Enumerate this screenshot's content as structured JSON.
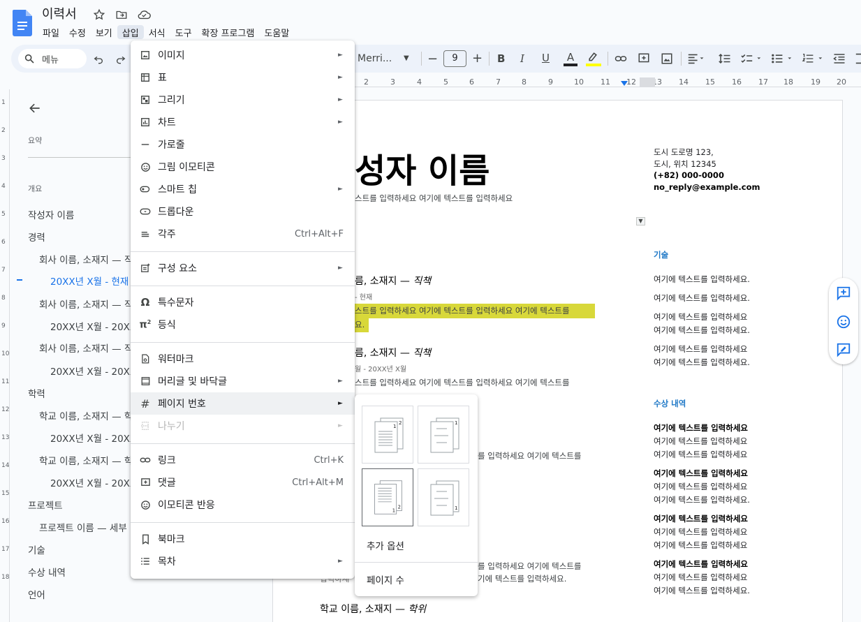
{
  "document": {
    "title": "이력서"
  },
  "menubar": [
    "파일",
    "수정",
    "보기",
    "삽입",
    "서식",
    "도구",
    "확장 프로그램",
    "도움말"
  ],
  "toolbar": {
    "menu_search": "메뉴",
    "font_name": "Merri...",
    "font_size": "9"
  },
  "ruler": [
    "2",
    "1",
    "1",
    "2",
    "3",
    "4",
    "5",
    "6",
    "7",
    "8",
    "9",
    "10",
    "11",
    "12",
    "13",
    "14",
    "15",
    "16",
    "17",
    "18",
    "19",
    "20"
  ],
  "vruler": [
    "1",
    "2",
    "3",
    "4",
    "5",
    "6",
    "7",
    "8",
    "9",
    "10",
    "11",
    "12",
    "13",
    "14",
    "15",
    "16",
    "17",
    "18"
  ],
  "outline": {
    "summary_label": "요약",
    "overview_label": "개요",
    "items": [
      "작성자 이름",
      "경력",
      "회사 이름, 소재지 — 직",
      "20XX년 X월 - 현재",
      "회사 이름, 소재지 — 직",
      "20XX년 X월 - 20XX",
      "회사 이름, 소재지 — 직",
      "20XX년 X월 - 20XX",
      "학력",
      "학교 이름, 소재지 — 학",
      "20XX년 X월 - 20XX",
      "학교 이름, 소재지 — 학",
      "20XX년 X월 - 20XX",
      "프로젝트",
      "프로젝트 이름 — 세부",
      "기술",
      "수상 내역",
      "언어"
    ]
  },
  "insert_menu": {
    "items": [
      {
        "label": "이미지",
        "icon": "image-icon",
        "submenu": true
      },
      {
        "label": "표",
        "icon": "table-icon",
        "submenu": true
      },
      {
        "label": "그리기",
        "icon": "drawing-icon",
        "submenu": true
      },
      {
        "label": "차트",
        "icon": "chart-icon",
        "submenu": true
      },
      {
        "label": "가로줄",
        "icon": "horizontal-line-icon",
        "submenu": false
      },
      {
        "label": "그림 이모티콘",
        "icon": "emoji-icon",
        "submenu": false
      },
      {
        "label": "스마트 칩",
        "icon": "smart-chip-icon",
        "submenu": true
      },
      {
        "label": "드롭다운",
        "icon": "dropdown-icon",
        "submenu": false
      },
      {
        "label": "각주",
        "icon": "footnote-icon",
        "submenu": false,
        "shortcut": "Ctrl+Alt+F"
      },
      {
        "label": "구성 요소",
        "icon": "building-blocks-icon",
        "submenu": true
      },
      {
        "label": "특수문자",
        "icon": "omega-icon",
        "submenu": false
      },
      {
        "label": "등식",
        "icon": "pi-icon",
        "submenu": false
      },
      {
        "label": "워터마크",
        "icon": "watermark-icon",
        "submenu": false
      },
      {
        "label": "머리글 및 바닥글",
        "icon": "header-footer-icon",
        "submenu": true
      },
      {
        "label": "페이지 번호",
        "icon": "hash-icon",
        "submenu": true
      },
      {
        "label": "나누기",
        "icon": "break-icon",
        "submenu": true
      },
      {
        "label": "링크",
        "icon": "link-icon",
        "submenu": false,
        "shortcut": "Ctrl+K"
      },
      {
        "label": "댓글",
        "icon": "comment-icon",
        "submenu": false,
        "shortcut": "Ctrl+Alt+M"
      },
      {
        "label": "이모티콘 반응",
        "icon": "emoji-reaction-icon",
        "submenu": false
      },
      {
        "label": "북마크",
        "icon": "bookmark-icon",
        "submenu": false
      },
      {
        "label": "목차",
        "icon": "toc-icon",
        "submenu": true
      }
    ]
  },
  "page_number_submenu": {
    "more_options": "추가 옵션",
    "page_count": "페이지 수"
  },
  "page": {
    "name": "성자 이름",
    "tagline": "스트를 입력하세요 여기에 텍스트를 입력하세요",
    "job1_title_a": "름, 소재지 — ",
    "job1_title_b": "직책",
    "job1_date": "- 현재",
    "job1_body_1": "스트를 입력하세요 여기에 텍스트를 입력하세요 여기에 텍스트를",
    "job1_body_2": "요.",
    "job2_title_a": "름, 소재지 — ",
    "job2_title_b": "직책",
    "job2_date": "월 - 20XX년 X월",
    "job2_body": "스트를 입력하세요 여기에 텍스트를 입력하세요 여기에 텍스트를",
    "job3_body": "를 입력하세요 여기에 텍스트를",
    "edu_body_1": "를 입력하세요 여기에 텍스트를",
    "edu_body_2_a": "입력하세",
    "edu_body_2_b": "기에 텍스트를 입력하세요.",
    "school_title_a": "학교 이름, 소재지 — ",
    "school_title_b": "학위",
    "address_1": "도시 도로명 123,",
    "address_2": "도시, 위치 12345",
    "phone": "(+82) 000-0000",
    "email": "no_reply@example.com",
    "skills_heading": "기술",
    "skills": [
      "여기에 텍스트를 입력하세요.",
      "여기에 텍스트를 입력하세요.",
      "여기에 텍스트를 입력하세요",
      "여기에 텍스트를 입력하세요.",
      "여기에 텍스트를 입력하세요",
      "여기에 텍스트를 입력하세요."
    ],
    "awards_heading": "수상 내역",
    "awards": [
      {
        "title": "여기에 텍스트를 입력하세요",
        "l1": "여기에 텍스트를 입력하세요",
        "l2": "여기에 텍스트를 입력하세요"
      },
      {
        "title": "여기에 텍스트를 입력하세요",
        "l1": "여기에 텍스트를 입력하세요",
        "l2": "여기에 텍스트를 입력하세요."
      },
      {
        "title": "여기에 텍스트를 입력하세요",
        "l1": "여기에 텍스트를 입력하세요",
        "l2": "여기에 텍스트를 입력하세요"
      },
      {
        "title": "여기에 텍스트를 입력하세요",
        "l1": "여기에 텍스트를 입력하세요",
        "l2": "여기에 텍스트를 입력하세요."
      }
    ]
  },
  "colors": {
    "accent": "#1a73e8",
    "heading_blue": "#2079c7",
    "highlight": "#d8d83a",
    "toolbar_bg": "#edf2fa"
  }
}
